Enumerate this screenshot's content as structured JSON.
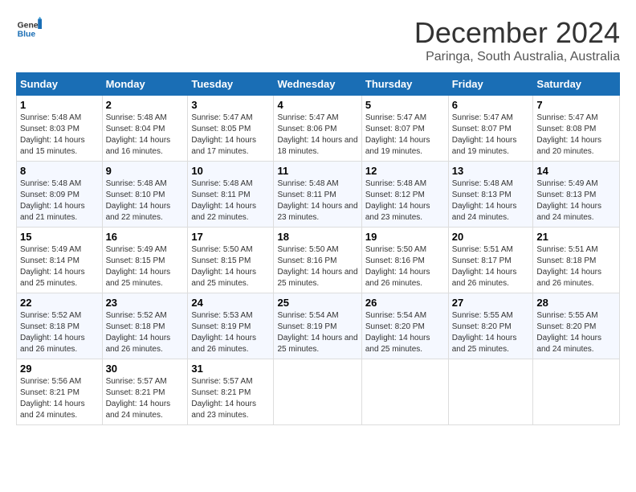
{
  "header": {
    "logo_general": "General",
    "logo_blue": "Blue",
    "title": "December 2024",
    "location": "Paringa, South Australia, Australia"
  },
  "weekdays": [
    "Sunday",
    "Monday",
    "Tuesday",
    "Wednesday",
    "Thursday",
    "Friday",
    "Saturday"
  ],
  "weeks": [
    [
      {
        "day": "1",
        "sunrise": "Sunrise: 5:48 AM",
        "sunset": "Sunset: 8:03 PM",
        "daylight": "Daylight: 14 hours and 15 minutes."
      },
      {
        "day": "2",
        "sunrise": "Sunrise: 5:48 AM",
        "sunset": "Sunset: 8:04 PM",
        "daylight": "Daylight: 14 hours and 16 minutes."
      },
      {
        "day": "3",
        "sunrise": "Sunrise: 5:47 AM",
        "sunset": "Sunset: 8:05 PM",
        "daylight": "Daylight: 14 hours and 17 minutes."
      },
      {
        "day": "4",
        "sunrise": "Sunrise: 5:47 AM",
        "sunset": "Sunset: 8:06 PM",
        "daylight": "Daylight: 14 hours and 18 minutes."
      },
      {
        "day": "5",
        "sunrise": "Sunrise: 5:47 AM",
        "sunset": "Sunset: 8:07 PM",
        "daylight": "Daylight: 14 hours and 19 minutes."
      },
      {
        "day": "6",
        "sunrise": "Sunrise: 5:47 AM",
        "sunset": "Sunset: 8:07 PM",
        "daylight": "Daylight: 14 hours and 19 minutes."
      },
      {
        "day": "7",
        "sunrise": "Sunrise: 5:47 AM",
        "sunset": "Sunset: 8:08 PM",
        "daylight": "Daylight: 14 hours and 20 minutes."
      }
    ],
    [
      {
        "day": "8",
        "sunrise": "Sunrise: 5:48 AM",
        "sunset": "Sunset: 8:09 PM",
        "daylight": "Daylight: 14 hours and 21 minutes."
      },
      {
        "day": "9",
        "sunrise": "Sunrise: 5:48 AM",
        "sunset": "Sunset: 8:10 PM",
        "daylight": "Daylight: 14 hours and 22 minutes."
      },
      {
        "day": "10",
        "sunrise": "Sunrise: 5:48 AM",
        "sunset": "Sunset: 8:11 PM",
        "daylight": "Daylight: 14 hours and 22 minutes."
      },
      {
        "day": "11",
        "sunrise": "Sunrise: 5:48 AM",
        "sunset": "Sunset: 8:11 PM",
        "daylight": "Daylight: 14 hours and 23 minutes."
      },
      {
        "day": "12",
        "sunrise": "Sunrise: 5:48 AM",
        "sunset": "Sunset: 8:12 PM",
        "daylight": "Daylight: 14 hours and 23 minutes."
      },
      {
        "day": "13",
        "sunrise": "Sunrise: 5:48 AM",
        "sunset": "Sunset: 8:13 PM",
        "daylight": "Daylight: 14 hours and 24 minutes."
      },
      {
        "day": "14",
        "sunrise": "Sunrise: 5:49 AM",
        "sunset": "Sunset: 8:13 PM",
        "daylight": "Daylight: 14 hours and 24 minutes."
      }
    ],
    [
      {
        "day": "15",
        "sunrise": "Sunrise: 5:49 AM",
        "sunset": "Sunset: 8:14 PM",
        "daylight": "Daylight: 14 hours and 25 minutes."
      },
      {
        "day": "16",
        "sunrise": "Sunrise: 5:49 AM",
        "sunset": "Sunset: 8:15 PM",
        "daylight": "Daylight: 14 hours and 25 minutes."
      },
      {
        "day": "17",
        "sunrise": "Sunrise: 5:50 AM",
        "sunset": "Sunset: 8:15 PM",
        "daylight": "Daylight: 14 hours and 25 minutes."
      },
      {
        "day": "18",
        "sunrise": "Sunrise: 5:50 AM",
        "sunset": "Sunset: 8:16 PM",
        "daylight": "Daylight: 14 hours and 25 minutes."
      },
      {
        "day": "19",
        "sunrise": "Sunrise: 5:50 AM",
        "sunset": "Sunset: 8:16 PM",
        "daylight": "Daylight: 14 hours and 26 minutes."
      },
      {
        "day": "20",
        "sunrise": "Sunrise: 5:51 AM",
        "sunset": "Sunset: 8:17 PM",
        "daylight": "Daylight: 14 hours and 26 minutes."
      },
      {
        "day": "21",
        "sunrise": "Sunrise: 5:51 AM",
        "sunset": "Sunset: 8:18 PM",
        "daylight": "Daylight: 14 hours and 26 minutes."
      }
    ],
    [
      {
        "day": "22",
        "sunrise": "Sunrise: 5:52 AM",
        "sunset": "Sunset: 8:18 PM",
        "daylight": "Daylight: 14 hours and 26 minutes."
      },
      {
        "day": "23",
        "sunrise": "Sunrise: 5:52 AM",
        "sunset": "Sunset: 8:18 PM",
        "daylight": "Daylight: 14 hours and 26 minutes."
      },
      {
        "day": "24",
        "sunrise": "Sunrise: 5:53 AM",
        "sunset": "Sunset: 8:19 PM",
        "daylight": "Daylight: 14 hours and 26 minutes."
      },
      {
        "day": "25",
        "sunrise": "Sunrise: 5:54 AM",
        "sunset": "Sunset: 8:19 PM",
        "daylight": "Daylight: 14 hours and 25 minutes."
      },
      {
        "day": "26",
        "sunrise": "Sunrise: 5:54 AM",
        "sunset": "Sunset: 8:20 PM",
        "daylight": "Daylight: 14 hours and 25 minutes."
      },
      {
        "day": "27",
        "sunrise": "Sunrise: 5:55 AM",
        "sunset": "Sunset: 8:20 PM",
        "daylight": "Daylight: 14 hours and 25 minutes."
      },
      {
        "day": "28",
        "sunrise": "Sunrise: 5:55 AM",
        "sunset": "Sunset: 8:20 PM",
        "daylight": "Daylight: 14 hours and 24 minutes."
      }
    ],
    [
      {
        "day": "29",
        "sunrise": "Sunrise: 5:56 AM",
        "sunset": "Sunset: 8:21 PM",
        "daylight": "Daylight: 14 hours and 24 minutes."
      },
      {
        "day": "30",
        "sunrise": "Sunrise: 5:57 AM",
        "sunset": "Sunset: 8:21 PM",
        "daylight": "Daylight: 14 hours and 24 minutes."
      },
      {
        "day": "31",
        "sunrise": "Sunrise: 5:57 AM",
        "sunset": "Sunset: 8:21 PM",
        "daylight": "Daylight: 14 hours and 23 minutes."
      },
      null,
      null,
      null,
      null
    ]
  ]
}
